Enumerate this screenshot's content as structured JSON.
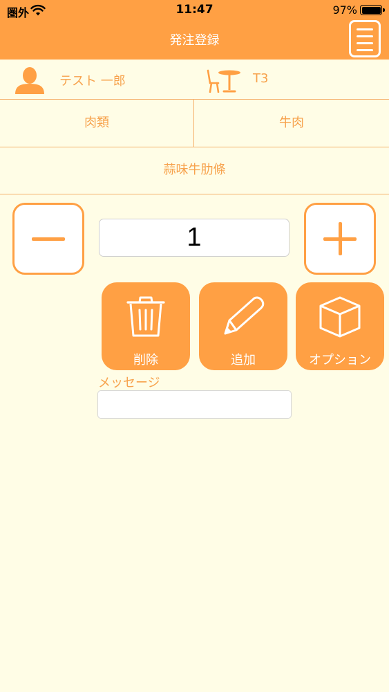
{
  "status_bar": {
    "carrier": "圏外",
    "time": "11:47",
    "battery": "97%"
  },
  "nav": {
    "title": "発注登録"
  },
  "info": {
    "user_name": "テスト 一郎",
    "table": "T3"
  },
  "categories": {
    "left": "肉類",
    "right": "牛肉"
  },
  "item": {
    "name": "蒜味牛肋條"
  },
  "quantity": {
    "value": "1"
  },
  "actions": {
    "delete": "削除",
    "add": "追加",
    "option": "オプション"
  },
  "message": {
    "label": "メッセージ",
    "value": ""
  },
  "colors": {
    "accent": "#ffa044",
    "text_accent": "#f7a24c",
    "background": "#fffde6"
  },
  "icons": {
    "menu": "menu-icon",
    "person": "person-icon",
    "table": "table-icon",
    "minus": "minus-icon",
    "plus": "plus-icon",
    "trash": "trash-icon",
    "pencil": "pencil-icon",
    "box": "box-icon",
    "wifi": "wifi-icon",
    "battery": "battery-icon"
  }
}
